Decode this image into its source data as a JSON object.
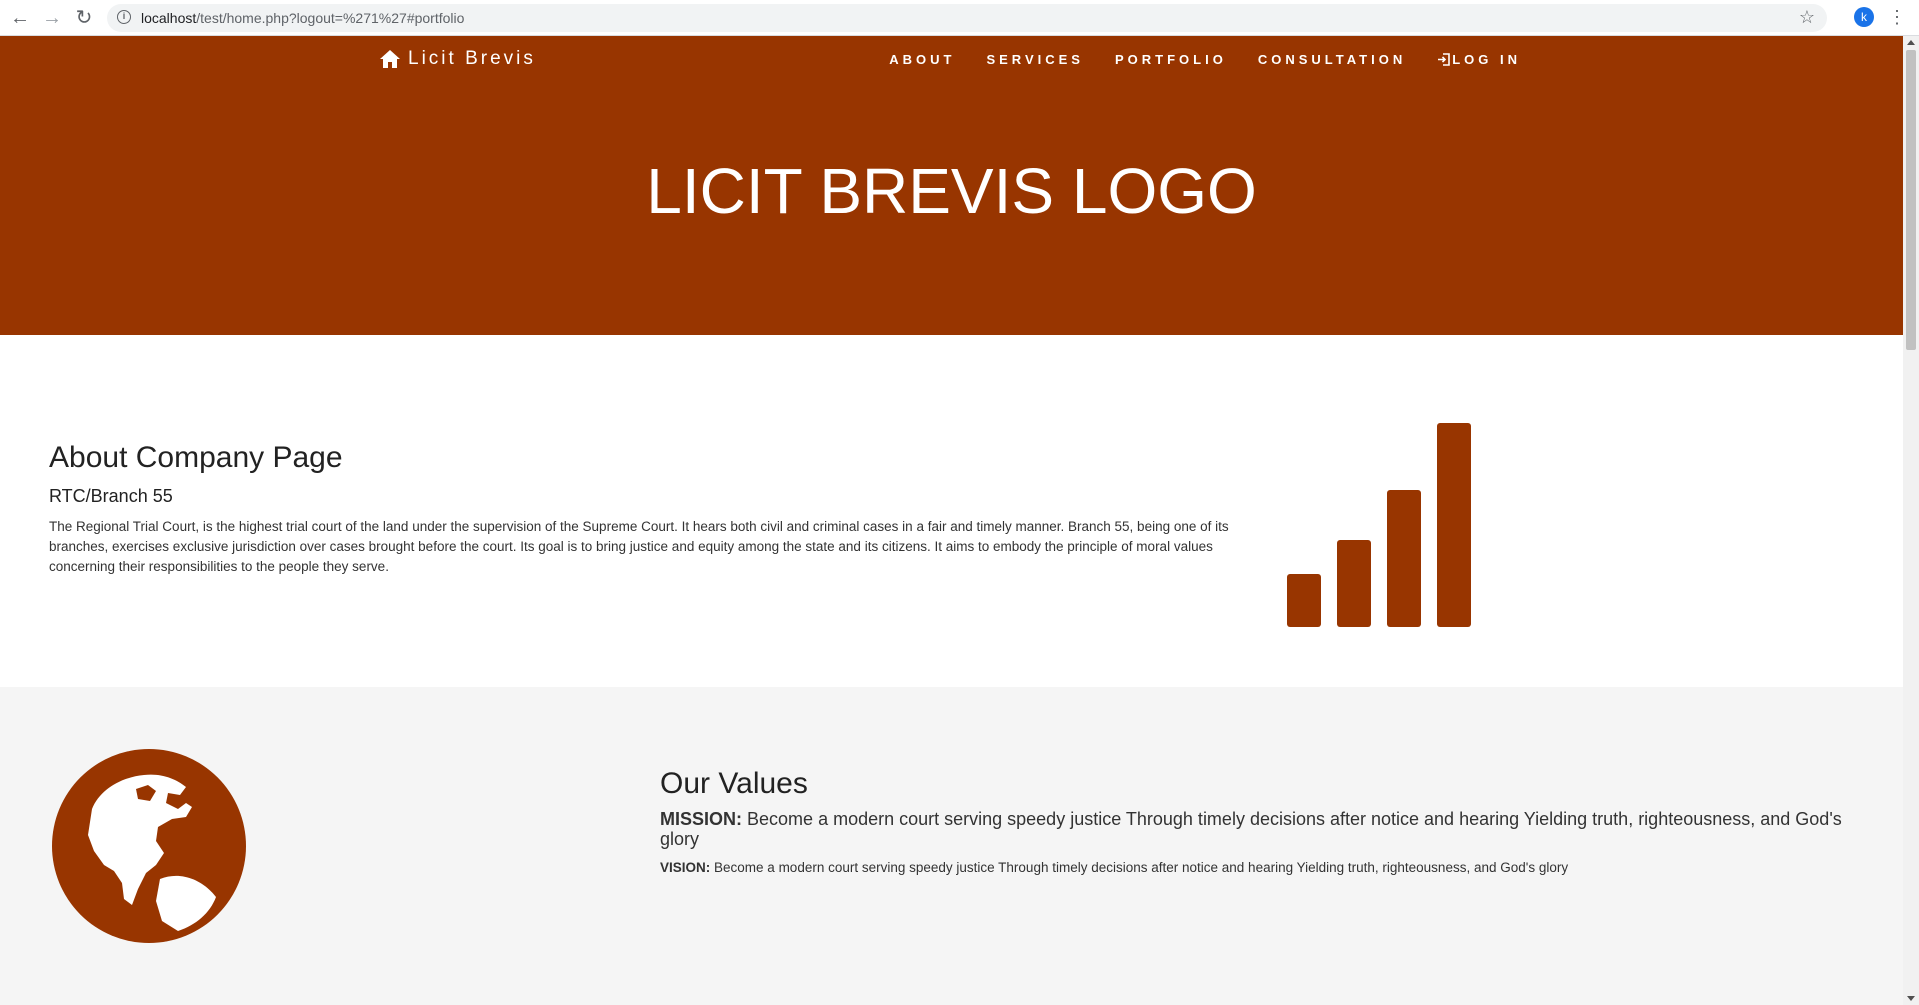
{
  "browser": {
    "url_host": "localhost",
    "url_path": "/test/home.php?logout=%271%27#portfolio",
    "profile_initial": "k"
  },
  "navbar": {
    "brand": "Licit Brevis",
    "items": [
      {
        "label": "ABOUT"
      },
      {
        "label": "SERVICES"
      },
      {
        "label": "PORTFOLIO"
      },
      {
        "label": "CONSULTATION"
      },
      {
        "label": "LOG IN"
      }
    ]
  },
  "hero": {
    "title": "LICIT BREVIS LOGO"
  },
  "about": {
    "heading": "About Company Page",
    "subheading": "RTC/Branch 55",
    "body": "The Regional Trial Court, is the highest trial court of the land under the supervision of the Supreme Court. It hears both civil and criminal cases in a fair and timely manner. Branch 55, being one of its branches, exercises exclusive jurisdiction over cases brought before the court. Its goal is to bring justice and equity among the state and its citizens. It aims to embody the principle of moral values concerning their responsibilities to the people they serve.",
    "icon": "signal-bars-icon"
  },
  "values": {
    "heading": "Our Values",
    "mission_label": "MISSION:",
    "mission_text": "Become a modern court serving speedy justice Through timely decisions after notice and hearing Yielding truth, righteousness, and God's glory",
    "vision_label": "VISION:",
    "vision_text": "Become a modern court serving speedy justice Through timely decisions after notice and hearing Yielding truth, righteousness, and God's glory",
    "icon": "globe-americas-icon"
  },
  "colors": {
    "brand": "#983500",
    "section_alt": "#f5f5f5"
  }
}
